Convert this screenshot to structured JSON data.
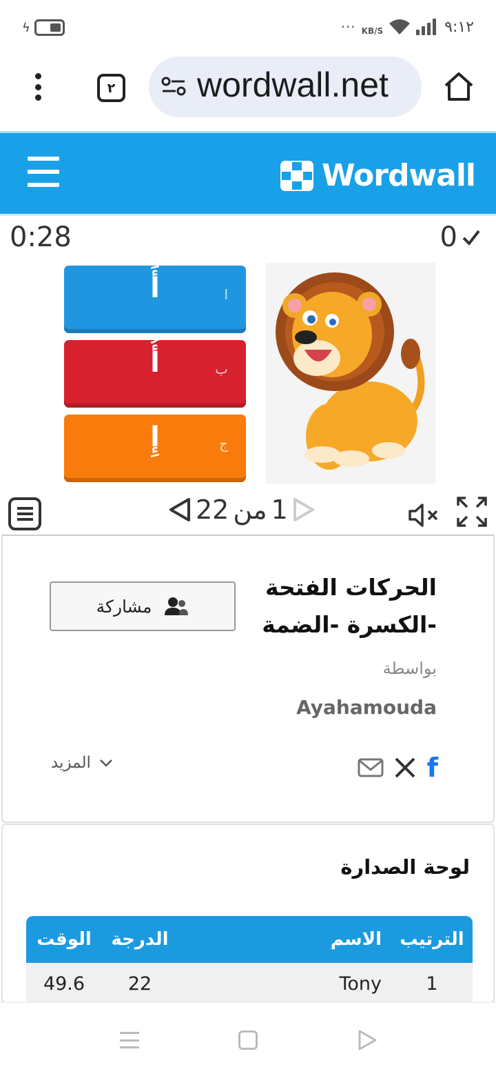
{
  "status_bar": {
    "time": "٩:١٢",
    "network_speed": "KB/S",
    "more_indicator": "···",
    "icons": [
      "charging-icon",
      "battery-icon",
      "wifi-icon",
      "signal-icon"
    ]
  },
  "browser": {
    "tab_count": "٢",
    "url": "wordwall.net",
    "icons": [
      "kebab-menu-icon",
      "site-settings-icon",
      "home-icon"
    ]
  },
  "site_header": {
    "logo_text": "Wordwall",
    "brand_color": "#18a0e8"
  },
  "game": {
    "timer": "0:28",
    "score": "0",
    "answers": [
      {
        "letter": "ا",
        "text": "أَ",
        "color": "#2196e0"
      },
      {
        "letter": "ب",
        "text": "أُ",
        "color": "#d8212f"
      },
      {
        "letter": "ج",
        "text": "إِ",
        "color": "#f97b0b"
      }
    ],
    "image": "lion-illustration",
    "pager": {
      "current": "1",
      "separator": "من",
      "total": "22"
    }
  },
  "activity": {
    "title": "الحركات الفتحة -الكسرة -الضمة",
    "share_label": "مشاركة",
    "by_label": "بواسطة",
    "author": "Ayahamouda",
    "more_label": "المزيد",
    "social_icons": [
      "facebook-icon",
      "x-icon",
      "email-icon"
    ]
  },
  "leaderboard": {
    "title": "لوحة الصدارة",
    "columns": {
      "rank": "الترتيب",
      "name": "الاسم",
      "score": "الدرجة",
      "time": "الوقت"
    },
    "rows": [
      {
        "rank": "1",
        "name": "Tony",
        "score": "22",
        "time": "49.6"
      }
    ]
  }
}
